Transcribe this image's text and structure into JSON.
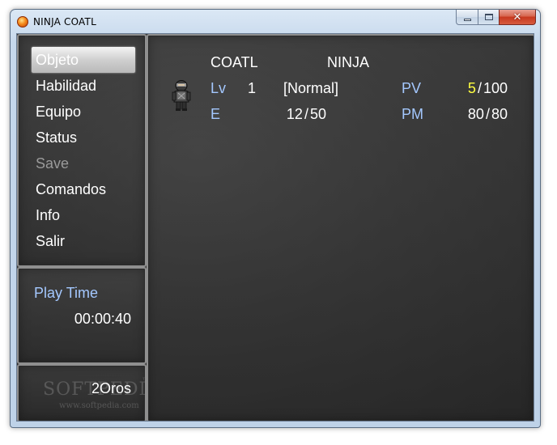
{
  "window": {
    "title": "NINJA COATL",
    "icon": "app-orb-icon",
    "controls": {
      "minimize": "minimize-icon",
      "maximize": "maximize-icon",
      "close": "close-icon",
      "close_glyph": "✕"
    }
  },
  "menu": {
    "items": [
      {
        "label": "Objeto",
        "state": "selected"
      },
      {
        "label": "Habilidad",
        "state": "enabled"
      },
      {
        "label": "Equipo",
        "state": "enabled"
      },
      {
        "label": "Status",
        "state": "enabled"
      },
      {
        "label": "Save",
        "state": "disabled"
      },
      {
        "label": "Comandos",
        "state": "enabled"
      },
      {
        "label": "Info",
        "state": "enabled"
      },
      {
        "label": "Salir",
        "state": "enabled"
      }
    ]
  },
  "playtime": {
    "label": "Play Time",
    "value": "00:00:40"
  },
  "gold": {
    "amount": "2",
    "unit": "Oros"
  },
  "watermark": {
    "brand": "SOFTPEDIA",
    "trademark": "™",
    "url": "www.softpedia.com"
  },
  "actor": {
    "name": "COATL",
    "class": "NINJA",
    "sprite": "ninja-character-sprite",
    "level_label": "Lv",
    "level": "1",
    "condition": "[Normal]",
    "exp_label": "E",
    "exp_current": "12",
    "exp_next": "50",
    "hp_label": "PV",
    "hp_current": "5",
    "hp_max": "100",
    "mp_label": "PM",
    "mp_current": "80",
    "mp_max": "80",
    "separator": "/"
  },
  "colors": {
    "system_blue": "#a4c8ff",
    "low_hp_yellow": "#ffff40",
    "disabled_grey": "#9a9a9a",
    "text_white": "#ffffff"
  }
}
